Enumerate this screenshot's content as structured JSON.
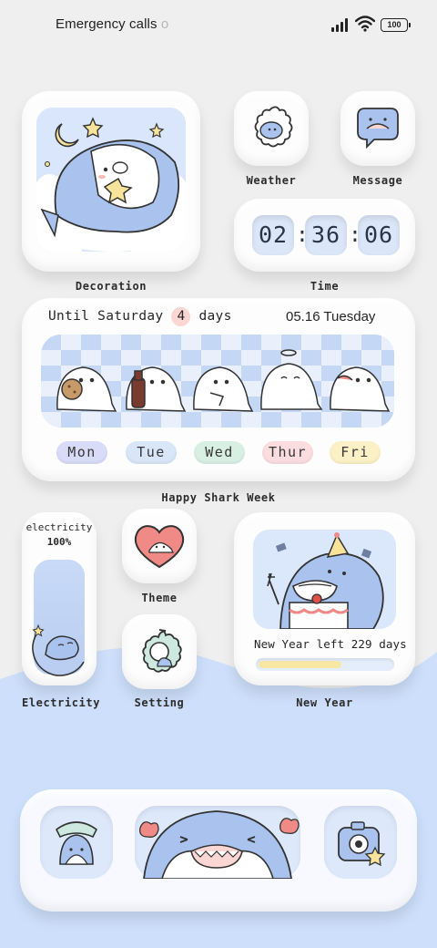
{
  "status_bar": {
    "carrier": "Emergency calls",
    "carrier_fade": "o",
    "battery": "100"
  },
  "widgets": {
    "decoration": {
      "label": "Decoration"
    },
    "weather": {
      "label": "Weather"
    },
    "message": {
      "label": "Message"
    },
    "time": {
      "label": "Time",
      "hours": "02",
      "minutes": "36",
      "seconds": "06",
      "separator": ":"
    },
    "shark_week": {
      "countdown_prefix": "Until Saturday",
      "countdown_number": "4",
      "countdown_suffix": "days",
      "date": "05.16 Tuesday",
      "days": [
        "Mon",
        "Tue",
        "Wed",
        "Thur",
        "Fri"
      ],
      "label": "Happy Shark Week"
    },
    "electricity": {
      "title": "electricity",
      "percent": "100%",
      "level": 1.0,
      "label": "Electricity"
    },
    "theme": {
      "label": "Theme"
    },
    "setting": {
      "label": "Setting"
    },
    "new_year": {
      "text": "New Year left 229 days",
      "progress": 0.62,
      "label": "New Year"
    }
  },
  "colors": {
    "background": "#efefef",
    "wave": "#cddffa",
    "pill_mon": "#d9dcf8",
    "pill_tue": "#d8e6f8",
    "pill_wed": "#d8efe4",
    "pill_thur": "#fbdde0",
    "pill_fri": "#fbf0c6",
    "shark": "#a9c3ee",
    "accent_red": "#f08a86",
    "accent_yellow": "#f8e39a"
  },
  "icons": {
    "decoration": "shark-moon-stars-icon",
    "weather": "sun-shark-icon",
    "message": "chat-bubble-shark-icon",
    "theme": "heart-shark-icon",
    "setting": "gear-shark-icon",
    "phone": "phone-shark-icon",
    "camera": "camera-icon"
  }
}
